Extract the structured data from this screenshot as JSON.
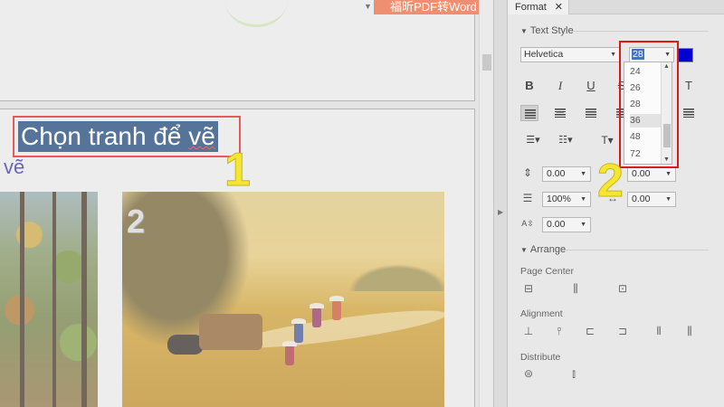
{
  "toolbar": {
    "pdf_convert_label": "福昕PDF转Word"
  },
  "canvas": {
    "title_text_main": "Chọn tranh để ",
    "title_text_underlined": "vẽ",
    "sub_text": "vẽ",
    "image_number": "2"
  },
  "annotations": {
    "step1": "1",
    "step2": "2"
  },
  "panel": {
    "tab_label": "Format",
    "tab_close": "✕",
    "text_style_title": "Text Style",
    "font_family_value": "Helvetica",
    "font_size_value": "28",
    "text_color": "#0000d0",
    "font_size_options": [
      "24",
      "26",
      "28",
      "36",
      "48",
      "72"
    ],
    "font_size_hovered": "36",
    "style_buttons": {
      "bold": "B",
      "italic": "I",
      "underline": "U",
      "strike": "S",
      "superscript": "T"
    },
    "line_spacing_value": "0.00",
    "char_spacing_value": "0.00",
    "scale_value": "100%",
    "indent_value": "0.00",
    "baseline_value": "0.00",
    "arrange_title": "Arrange",
    "page_center_label": "Page Center",
    "alignment_label": "Alignment",
    "distribute_label": "Distribute"
  }
}
